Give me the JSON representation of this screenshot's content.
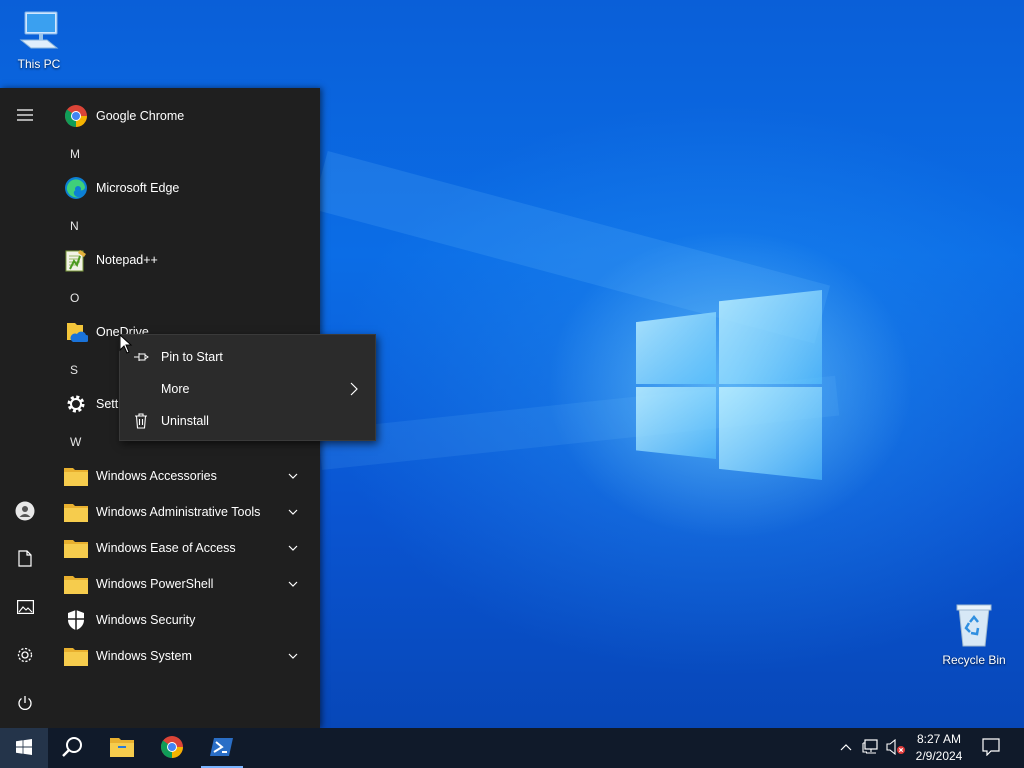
{
  "desktop": {
    "icons": [
      {
        "label": "This PC",
        "icon": "computer-icon"
      },
      {
        "label": "Recycle Bin",
        "icon": "recycle-bin-icon"
      }
    ]
  },
  "start_menu": {
    "rail": [
      {
        "icon": "hamburger-menu-icon"
      },
      {
        "icon": "user-account-icon"
      },
      {
        "icon": "documents-icon"
      },
      {
        "icon": "pictures-icon"
      },
      {
        "icon": "settings-gear-icon"
      },
      {
        "icon": "power-icon"
      }
    ],
    "apps": {
      "google_chrome": "Google Chrome",
      "letter_m": "M",
      "microsoft_edge": "Microsoft Edge",
      "letter_n": "N",
      "notepadpp": "Notepad++",
      "letter_o": "O",
      "onedrive": "OneDrive",
      "letter_s": "S",
      "settings": "Setti",
      "letter_w": "W",
      "windows_accessories": "Windows Accessories",
      "windows_admin_tools": "Windows Administrative Tools",
      "windows_ease": "Windows Ease of Access",
      "windows_powershell": "Windows PowerShell",
      "windows_security": "Windows Security",
      "windows_system": "Windows System"
    }
  },
  "context_menu": {
    "pin_to_start": "Pin to Start",
    "more": "More",
    "uninstall": "Uninstall"
  },
  "taskbar": {
    "pinned": [
      "start-icon",
      "search-icon",
      "file-explorer-icon",
      "chrome-icon",
      "powershell-icon"
    ],
    "tray": [
      "show-hidden-icons-chevron",
      "network-icon",
      "volume-muted-icon"
    ],
    "clock_time": "8:27 AM",
    "clock_date": "2/9/2024",
    "notification": "action-center-icon"
  },
  "colors": {
    "start_bg": "#1f1f1f",
    "context_bg": "#2b2b2b",
    "taskbar_bg": "#101a2a",
    "folder_yellow": "#f3c53a",
    "accent_blue": "#0a5fd8"
  }
}
